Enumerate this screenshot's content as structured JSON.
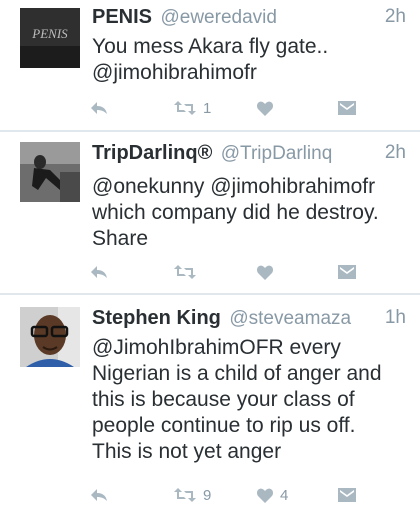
{
  "icons": {
    "reply": "reply-arrow-icon",
    "retweet": "retweet-icon",
    "favorite": "heart-icon",
    "message": "direct-message-icon"
  },
  "colors": {
    "name": "#292f33",
    "meta": "#8899a6",
    "icon": "#aab8c2",
    "divider": "#e1e8ed"
  },
  "tweets": [
    {
      "name": "PENIS",
      "handle": "@eweredavid",
      "time": "2h",
      "lines": [
        "You mess Akara fly gate..",
        "@jimohibrahimofr"
      ],
      "retweets": "1",
      "favorites": "",
      "avatar_text": "PENIS"
    },
    {
      "name": "TripDarlinq®",
      "handle": "@TripDarlinq",
      "time": "2h",
      "lines": [
        "@onekunny @jimohibrahimofr",
        "which company did he destroy.",
        "Share"
      ],
      "retweets": "",
      "favorites": ""
    },
    {
      "name": "Stephen King",
      "handle": "@steveamaza",
      "time": "1h",
      "lines": [
        "@JimohIbrahimOFR every",
        "Nigerian is a child of anger and",
        "this is because your class of",
        "people continue to rip us off.",
        "This is not yet anger"
      ],
      "retweets": "9",
      "favorites": "4"
    }
  ]
}
